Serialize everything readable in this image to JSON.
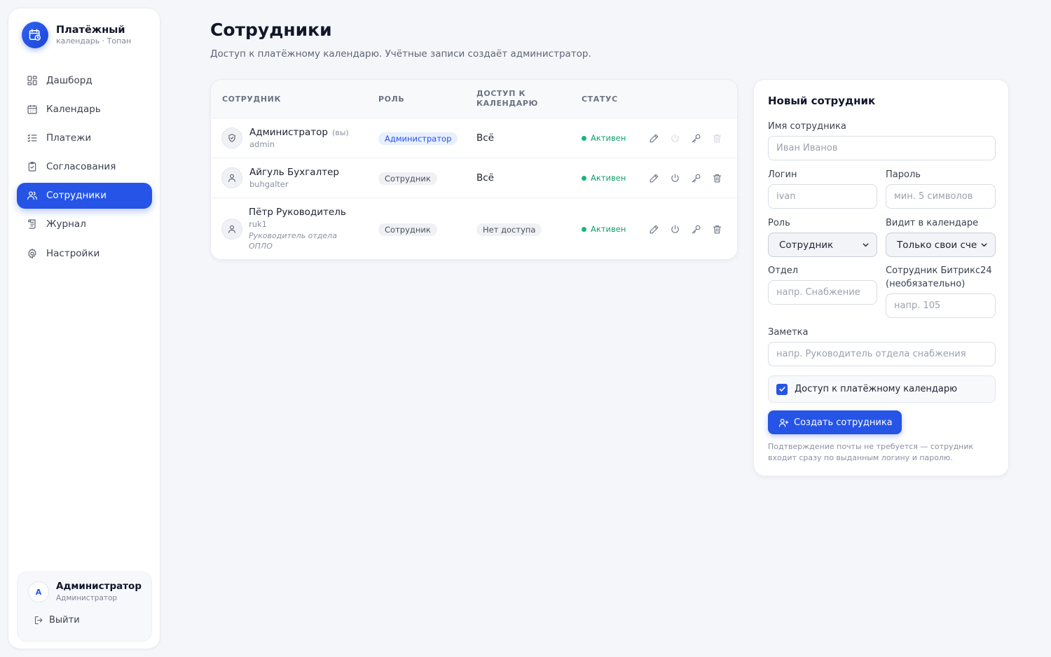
{
  "brand": {
    "title": "Платёжный",
    "subtitle": "календарь · Топан"
  },
  "nav": [
    {
      "label": "Дашборд",
      "icon": "dashboard-icon"
    },
    {
      "label": "Календарь",
      "icon": "calendar-icon"
    },
    {
      "label": "Платежи",
      "icon": "list-check-icon"
    },
    {
      "label": "Согласования",
      "icon": "clipboard-check-icon"
    },
    {
      "label": "Сотрудники",
      "icon": "users-icon",
      "active": true
    },
    {
      "label": "Журнал",
      "icon": "scroll-icon"
    },
    {
      "label": "Настройки",
      "icon": "gear-icon"
    }
  ],
  "user": {
    "initial": "A",
    "name": "Администратор",
    "role": "Администратор",
    "logout_label": "Выйти"
  },
  "page": {
    "title": "Сотрудники",
    "subtitle": "Доступ к платёжному календарю. Учётные записи создаёт администратор."
  },
  "table": {
    "headers": {
      "employee": "Сотрудник",
      "role": "Роль",
      "access": "Доступ к календарю",
      "status": "Статус"
    },
    "rows": [
      {
        "name": "Администратор",
        "you": "(вы)",
        "login": "admin",
        "note": "",
        "role": "Администратор",
        "access": "Всё",
        "status": "Активен"
      },
      {
        "name": "Айгуль Бухгалтер",
        "you": "",
        "login": "buhgalter",
        "note": "",
        "role": "Сотрудник",
        "access": "Всё",
        "status": "Активен"
      },
      {
        "name": "Пётр Руководитель",
        "you": "",
        "login": "ruk1",
        "note": "Руководитель отдела ОПЛО",
        "role": "Сотрудник",
        "access": "Нет доступа",
        "status": "Активен"
      }
    ]
  },
  "form": {
    "title": "Новый сотрудник",
    "name_label": "Имя сотрудника",
    "name_placeholder": "Иван Иванов",
    "login_label": "Логин",
    "login_placeholder": "ivan",
    "password_label": "Пароль",
    "password_placeholder": "мин. 5 символов",
    "role_label": "Роль",
    "role_value": "Сотрудник",
    "visibility_label": "Видит в календаре",
    "visibility_value": "Только свои счет",
    "department_label": "Отдел",
    "department_placeholder": "напр. Снабжение",
    "bitrix_label_1": "Сотрудник Битрикс24",
    "bitrix_label_2": "(необязательно)",
    "bitrix_placeholder": "напр. 105",
    "note_label": "Заметка",
    "note_placeholder": "напр. Руководитель отдела снабжения",
    "access_checkbox_label": "Доступ к платёжному календарю",
    "access_checked": true,
    "submit_label": "Создать сотрудника",
    "hint": "Подтверждение почты не требуется — сотрудник входит сразу по выданным логину и паролю."
  },
  "colors": {
    "accent": "#2554e6",
    "success": "#19b57a",
    "background": "#f5f6f9"
  }
}
